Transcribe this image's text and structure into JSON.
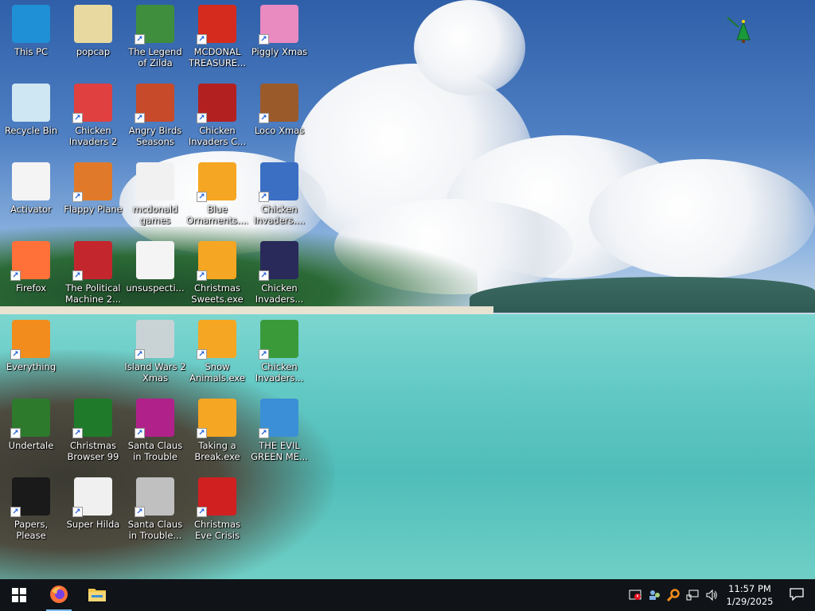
{
  "desktop": {
    "icons": [
      {
        "label": "This PC",
        "icon": "computer-icon",
        "color": "#1f8fd6"
      },
      {
        "label": "popcap",
        "icon": "folder-icon",
        "color": "#e8d9a0"
      },
      {
        "label": "The Legend of Zilda",
        "icon": "game-character-icon",
        "color": "#3e8e3e"
      },
      {
        "label": "MCDONAL TREASURE...",
        "icon": "mcdonalds-icon",
        "color": "#d52b1e"
      },
      {
        "label": "Piggly Xmas",
        "icon": "pig-icon",
        "color": "#e98ac0"
      },
      {
        "label": "Recycle Bin",
        "icon": "recycle-bin-icon",
        "color": "#cfe7f2"
      },
      {
        "label": "Chicken Invaders 2",
        "icon": "chicken-icon",
        "color": "#e04040"
      },
      {
        "label": "Angry Birds Seasons",
        "icon": "angry-bird-icon",
        "color": "#c74a2a"
      },
      {
        "label": "Chicken Invaders C...",
        "icon": "snowman-chicken-icon",
        "color": "#b32020"
      },
      {
        "label": "Loco Xmas",
        "icon": "bear-icon",
        "color": "#9b5a2a"
      },
      {
        "label": "Activator",
        "icon": "file-icon",
        "color": "#f4f4f4"
      },
      {
        "label": "Flappy Plane",
        "icon": "plane-icon",
        "color": "#e07a2a"
      },
      {
        "label": "mcdonald games",
        "icon": "folder-icon",
        "color": "#f1f1f1"
      },
      {
        "label": "Blue Ornaments....",
        "icon": "installer-icon",
        "color": "#f5a623"
      },
      {
        "label": "Chicken Invaders....",
        "icon": "chicken-santa-icon",
        "color": "#3a6fc4"
      },
      {
        "label": "Firefox",
        "icon": "firefox-icon",
        "color": "#ff7139"
      },
      {
        "label": "The Political Machine 2...",
        "icon": "political-icon",
        "color": "#c4262e"
      },
      {
        "label": "unsuspecti...",
        "icon": "file-icon",
        "color": "#f4f4f4"
      },
      {
        "label": "Christmas Sweets.exe",
        "icon": "installer-icon",
        "color": "#f5a623"
      },
      {
        "label": "Chicken Invaders...",
        "icon": "chicken-ship-icon",
        "color": "#2a2a5a"
      },
      {
        "label": "Everything",
        "icon": "search-icon",
        "color": "#f28c1c"
      },
      {
        "label": "Island Wars 2 Xmas",
        "icon": "island-icon",
        "color": "#c9d3d6"
      },
      {
        "label": "Snow Animals.exe",
        "icon": "installer-icon",
        "color": "#f5a623"
      },
      {
        "label": "Chicken Invaders...",
        "icon": "chicken-green-icon",
        "color": "#3a9a3a"
      },
      {
        "label": "Undertale",
        "icon": "undertale-icon",
        "color": "#2d7a2d"
      },
      {
        "label": "Christmas Browser 99",
        "icon": "christmas-tree-icon",
        "color": "#1f7a2a"
      },
      {
        "label": "Santa Claus in Trouble",
        "icon": "santa-icon",
        "color": "#b0228a"
      },
      {
        "label": "Taking a Break.exe",
        "icon": "installer-icon",
        "color": "#f5a623"
      },
      {
        "label": "THE EVIL GREEN ME...",
        "icon": "messenger-icon",
        "color": "#3a8fd6"
      },
      {
        "label": "Papers, Please",
        "icon": "papers-please-icon",
        "color": "#1a1a1a"
      },
      {
        "label": "Super Hilda",
        "icon": "pixel-character-icon",
        "color": "#f0f0f0"
      },
      {
        "label": "Santa Claus in Trouble... A...",
        "icon": "santa-icon",
        "color": "#c0c0c0"
      },
      {
        "label": "Christmas Eve Crisis",
        "icon": "santa-face-icon",
        "color": "#d02020"
      }
    ]
  },
  "taskbar": {
    "start_icon": "windows-start-icon",
    "pinned": [
      {
        "name": "Firefox",
        "icon": "firefox-icon",
        "active": true
      },
      {
        "name": "File Explorer",
        "icon": "folder-icon",
        "active": false
      }
    ],
    "tray_icons": [
      "security-alert-icon",
      "network-user-icon",
      "search-everything-icon",
      "network-icon",
      "volume-icon"
    ],
    "time": "11:57 PM",
    "date": "1/29/2025",
    "notification_icon": "notification-icon"
  }
}
